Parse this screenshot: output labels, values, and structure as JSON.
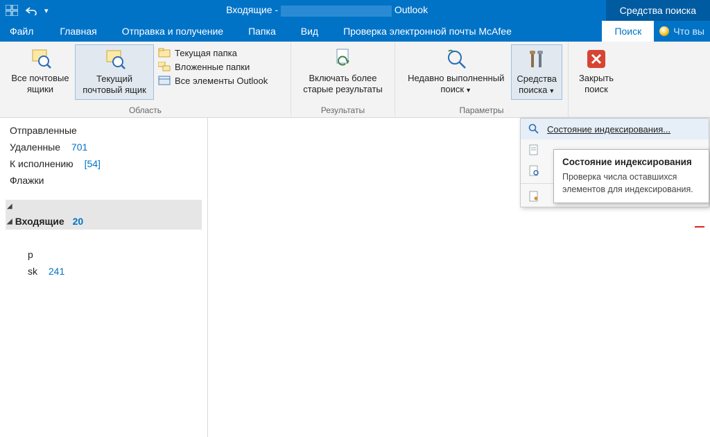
{
  "titlebar": {
    "title_prefix": "Входящие - ",
    "title_suffix": " Outlook",
    "context_tab": "Средства поиска"
  },
  "tabs": {
    "file": "Файл",
    "home": "Главная",
    "sendreceive": "Отправка и получение",
    "folder": "Папка",
    "view": "Вид",
    "mcafee": "Проверка электронной почты McAfee",
    "search": "Поиск",
    "tellme": "Что вы"
  },
  "ribbon": {
    "scope": {
      "all_mailboxes": "Все почтовые ящики",
      "current_mailbox": "Текущий почтовый ящик",
      "current_folder": "Текущая папка",
      "subfolders": "Вложенные папки",
      "all_outlook": "Все элементы Outlook",
      "group_label": "Область"
    },
    "results": {
      "include_older": "Включать более старые результаты",
      "group_label": "Результаты"
    },
    "options": {
      "recent_searches": "Недавно выполненный поиск",
      "search_tools": "Средства поиска",
      "group_label": "Параметры"
    },
    "close": {
      "close_search": "Закрыть поиск"
    }
  },
  "dropdown": {
    "indexing_status": "Состояние индексирования..."
  },
  "tooltip": {
    "title": "Состояние индексирования",
    "body": "Проверка числа оставшихся элементов для индексирования."
  },
  "folders": {
    "sent": "Отправленные",
    "deleted": "Удаленные",
    "deleted_count": "701",
    "followup": "К исполнению",
    "followup_count": "[54]",
    "flags": "Флажки",
    "inbox": "Входящие",
    "inbox_count": "20",
    "sub_p": "р",
    "sub_sk": "sk",
    "sub_sk_count": "241"
  }
}
